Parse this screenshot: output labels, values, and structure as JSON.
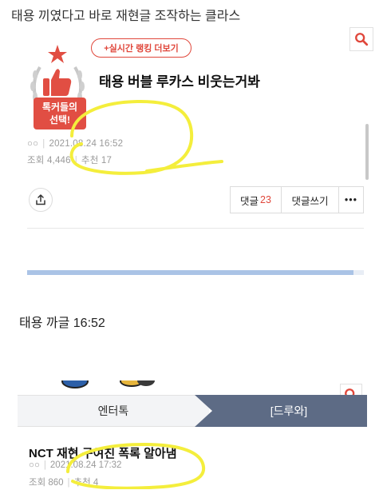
{
  "caption": "태용 끼였다고 바로 재현글 조작하는 클라스",
  "screenshot1": {
    "realtime_button": "+실시간 랭킹 더보기",
    "badge_line1": "톡커들의",
    "badge_line2": "선택!",
    "post_title": "태용 버블 루카스 비웃는거봐",
    "author": "○○",
    "date": "2021.08.24 16:52",
    "views": "조회 4,446",
    "recommend": "추천 17",
    "comments_label": "댓글",
    "comments_count": "23",
    "write_comment": "댓글쓰기",
    "more": "•••",
    "progress": 0.97
  },
  "middle_text": "태용 까글 16:52",
  "screenshot2": {
    "tab_left": "엔터톡",
    "tab_right": "[드루와]",
    "post_title": "NCT 재현 구여친 폭록 알아냄",
    "author": "○○",
    "date": "2021.08.24 17:32",
    "views": "조회 860",
    "recommend": "추천 4"
  },
  "colors": {
    "accent_red": "#e0473b",
    "tab_active": "#5d6b85",
    "highlight_yellow": "#f4ee3c"
  },
  "icons": [
    "search-icon",
    "share-icon",
    "laurel-thumbs-up-icon"
  ]
}
